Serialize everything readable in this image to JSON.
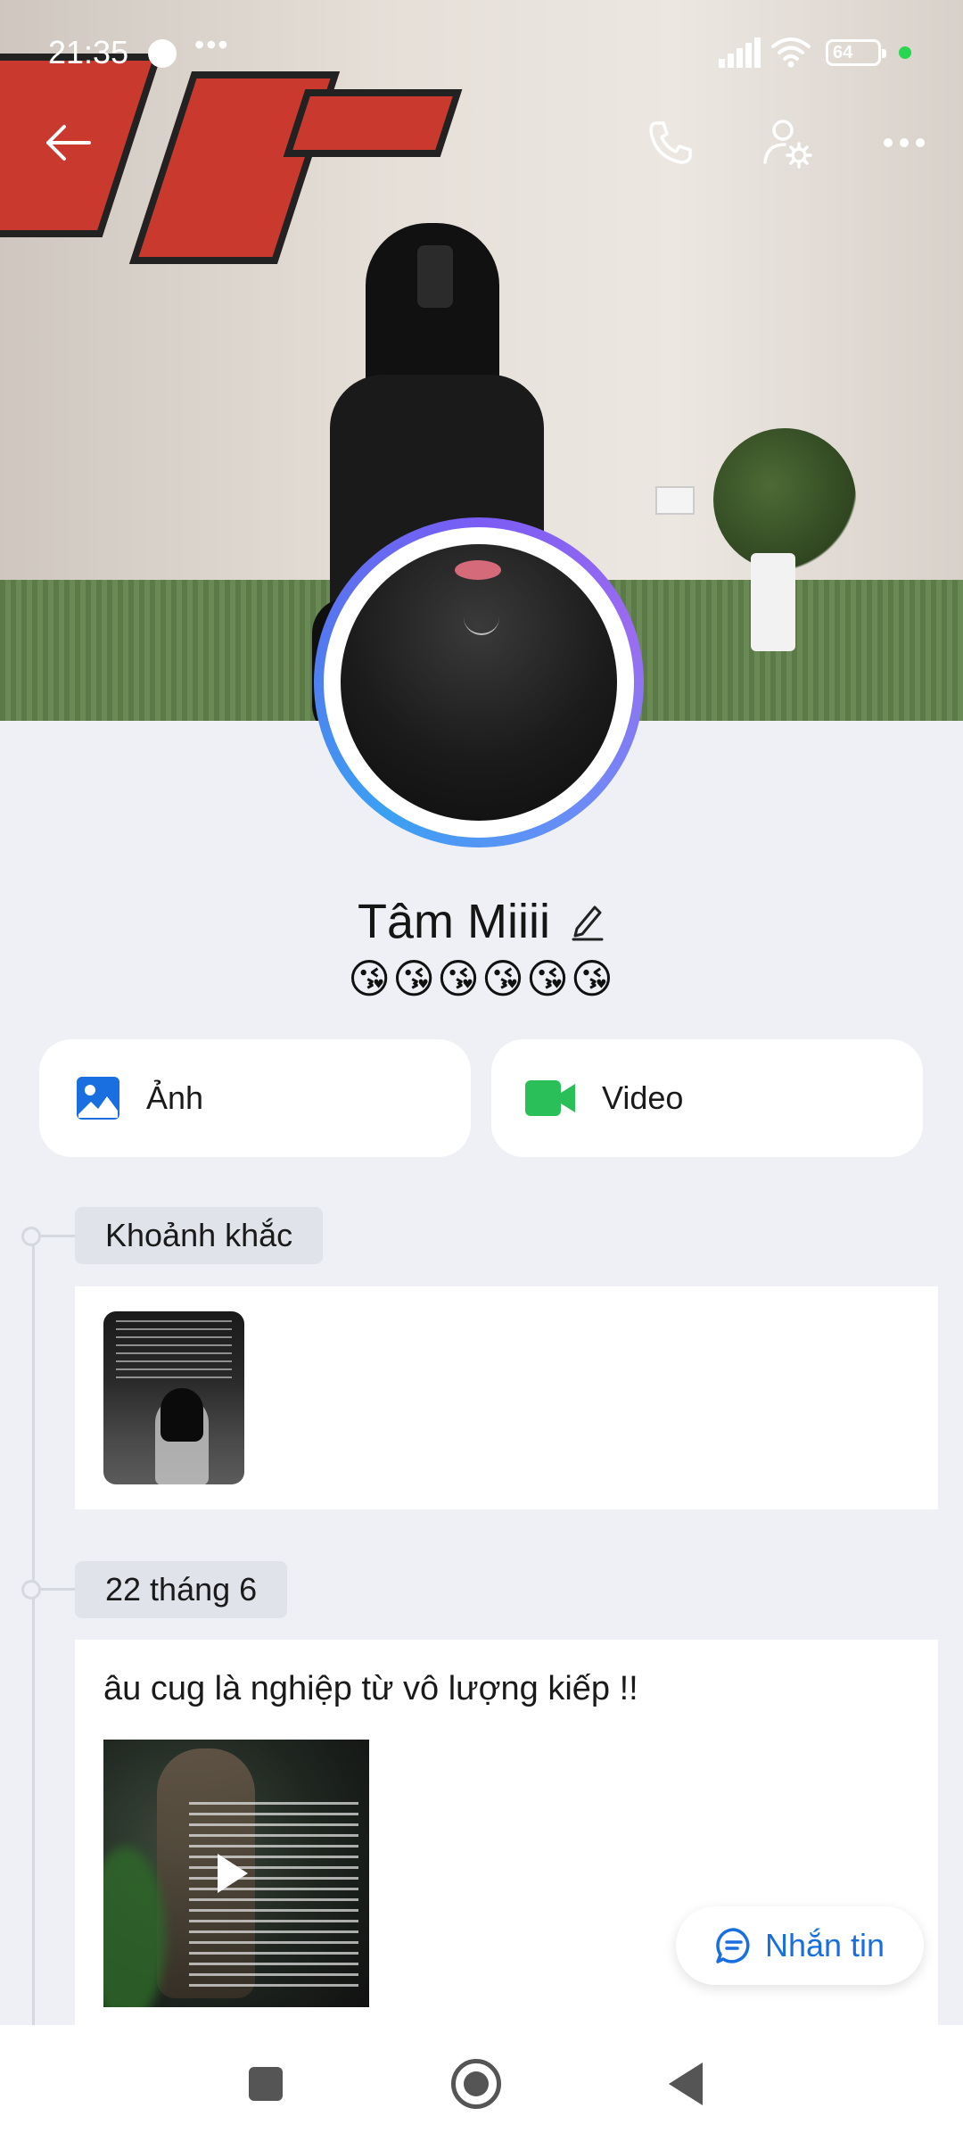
{
  "status_bar": {
    "time": "21:35",
    "dots": "•••",
    "battery": "64"
  },
  "profile": {
    "name": "Tâm Miiii",
    "bio": "😘😘😘😘😘😘"
  },
  "media_buttons": [
    {
      "label": "Ảnh",
      "icon": "image-icon",
      "color": "#1a6fe0"
    },
    {
      "label": "Video",
      "icon": "video-camera-icon",
      "color": "#2bbf5a"
    }
  ],
  "timeline": {
    "sections": [
      {
        "tag": "Khoảnh khắc"
      },
      {
        "tag": "22 tháng 6",
        "post_text": "âu cug là nghiệp từ vô lượng kiếp !!"
      }
    ]
  },
  "message_button": {
    "label": "Nhắn tin"
  },
  "colors": {
    "accent": "#1a6fe0",
    "page_bg": "#eef0f5",
    "online": "#29d650"
  }
}
